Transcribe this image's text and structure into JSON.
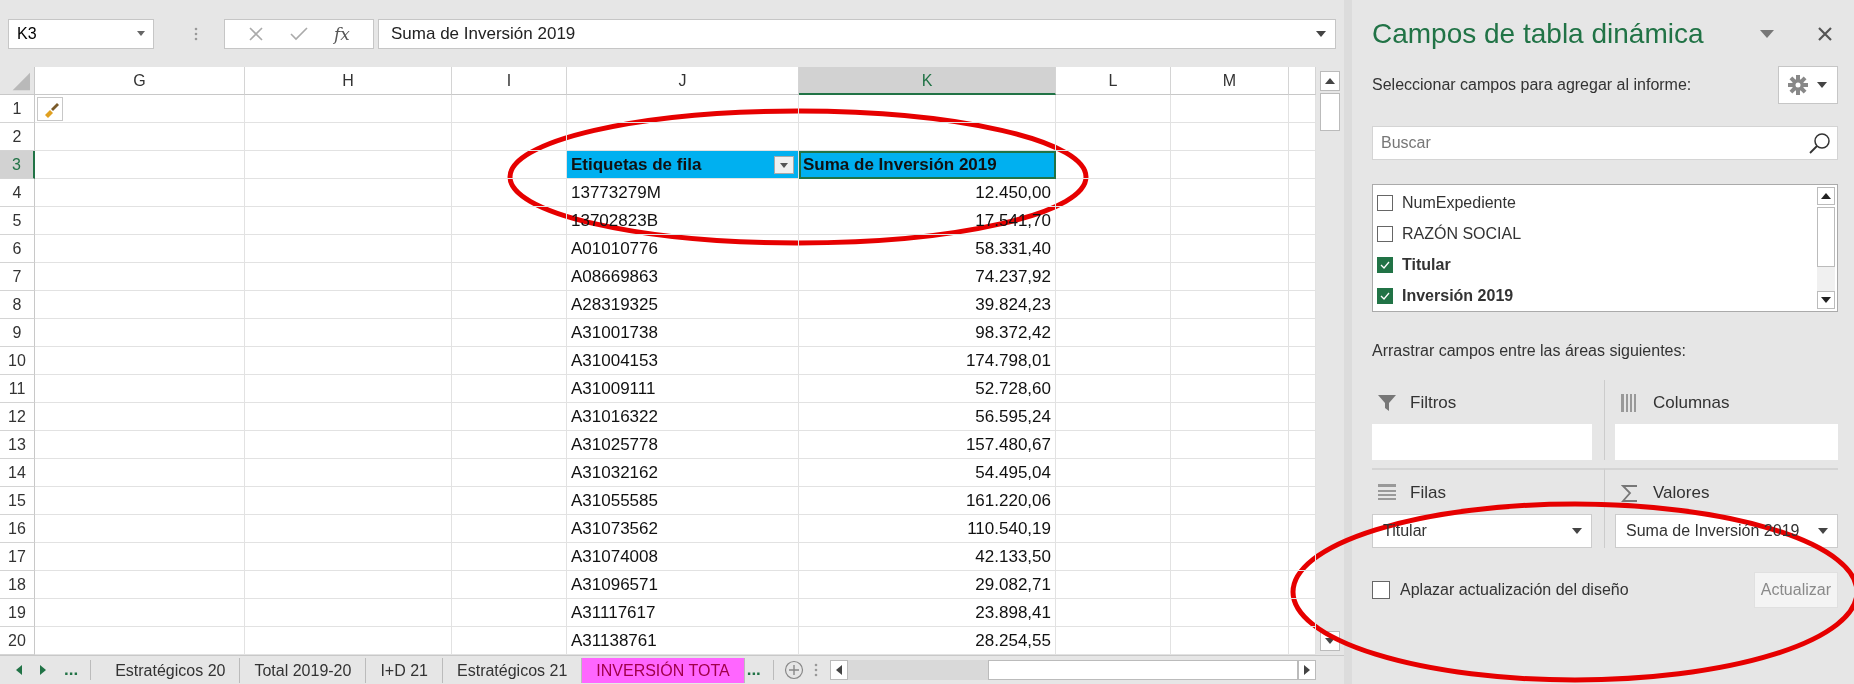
{
  "name_box": "K3",
  "formula_bar": {
    "fx": "fx",
    "value": "Suma de Inversión 2019"
  },
  "columns": [
    {
      "label": "G",
      "selected": false
    },
    {
      "label": "H",
      "selected": false
    },
    {
      "label": "I",
      "selected": false
    },
    {
      "label": "J",
      "selected": false
    },
    {
      "label": "K",
      "selected": true
    },
    {
      "label": "L",
      "selected": false
    },
    {
      "label": "M",
      "selected": false
    }
  ],
  "row_numbers": [
    {
      "label": "1",
      "selected": false
    },
    {
      "label": "2",
      "selected": false
    },
    {
      "label": "3",
      "selected": true
    },
    {
      "label": "4",
      "selected": false
    },
    {
      "label": "5",
      "selected": false
    },
    {
      "label": "6",
      "selected": false
    },
    {
      "label": "7",
      "selected": false
    },
    {
      "label": "8",
      "selected": false
    },
    {
      "label": "9",
      "selected": false
    },
    {
      "label": "10",
      "selected": false
    },
    {
      "label": "11",
      "selected": false
    },
    {
      "label": "12",
      "selected": false
    },
    {
      "label": "13",
      "selected": false
    },
    {
      "label": "14",
      "selected": false
    },
    {
      "label": "15",
      "selected": false
    },
    {
      "label": "16",
      "selected": false
    },
    {
      "label": "17",
      "selected": false
    },
    {
      "label": "18",
      "selected": false
    },
    {
      "label": "19",
      "selected": false
    },
    {
      "label": "20",
      "selected": false
    }
  ],
  "pivot": {
    "header": [
      {
        "text": "Etiquetas de fila",
        "filter": true,
        "selected": false
      },
      {
        "text": "Suma de Inversión 2019",
        "filter": false,
        "selected": true
      }
    ],
    "rows": [
      {
        "label": "13773279M",
        "value": "12.450,00"
      },
      {
        "label": "13702823B",
        "value": "17.541,70"
      },
      {
        "label": "A01010776",
        "value": "58.331,40"
      },
      {
        "label": "A08669863",
        "value": "74.237,92"
      },
      {
        "label": "A28319325",
        "value": "39.824,23"
      },
      {
        "label": "A31001738",
        "value": "98.372,42"
      },
      {
        "label": "A31004153",
        "value": "174.798,01"
      },
      {
        "label": "A31009111",
        "value": "52.728,60"
      },
      {
        "label": "A31016322",
        "value": "56.595,24"
      },
      {
        "label": "A31025778",
        "value": "157.480,67"
      },
      {
        "label": "A31032162",
        "value": "54.495,04"
      },
      {
        "label": "A31055585",
        "value": "161.220,06"
      },
      {
        "label": "A31073562",
        "value": "110.540,19"
      },
      {
        "label": "A31074008",
        "value": "42.133,50"
      },
      {
        "label": "A31096571",
        "value": "29.082,71"
      },
      {
        "label": "A31117617",
        "value": "23.898,41"
      },
      {
        "label": "A31138761",
        "value": "28.254,55"
      }
    ]
  },
  "sheet_tabs": {
    "more_left": "...",
    "more_right": "...",
    "tabs": [
      {
        "label": "Estratégicos 20",
        "selected": false
      },
      {
        "label": "Total 2019-20",
        "selected": false
      },
      {
        "label": "I+D 21",
        "selected": false
      },
      {
        "label": "Estratégicos 21",
        "selected": false
      },
      {
        "label": "INVERSIÓN TOTA",
        "selected": true
      }
    ]
  },
  "panel": {
    "title": "Campos de tabla dinámica",
    "prompt": "Seleccionar campos para agregar al informe:",
    "search": {
      "placeholder": "Buscar"
    },
    "fields": [
      {
        "label": "NumExpediente",
        "checked": false
      },
      {
        "label": "RAZÓN SOCIAL",
        "checked": false
      },
      {
        "label": "Titular",
        "checked": true
      },
      {
        "label": "Inversión 2019",
        "checked": true
      }
    ],
    "areas_prompt": "Arrastrar campos entre las áreas siguientes:",
    "areas": [
      {
        "kind": "filters",
        "label": "Filtros"
      },
      {
        "kind": "columns",
        "label": "Columnas"
      },
      {
        "kind": "rows",
        "label": "Filas",
        "value": "Titular"
      },
      {
        "kind": "values",
        "label": "Valores",
        "value": "Suma de Inversión 2019"
      }
    ],
    "defer": {
      "label": "Aplazar actualización del diseño",
      "checked": false
    },
    "update_button": {
      "label": "Actualizar",
      "disabled": true
    }
  }
}
